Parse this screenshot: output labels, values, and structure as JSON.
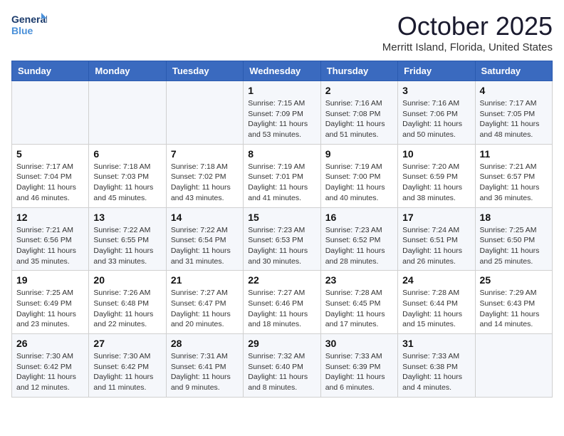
{
  "header": {
    "logo_line1": "General",
    "logo_line2": "Blue",
    "month": "October 2025",
    "location": "Merritt Island, Florida, United States"
  },
  "days_of_week": [
    "Sunday",
    "Monday",
    "Tuesday",
    "Wednesday",
    "Thursday",
    "Friday",
    "Saturday"
  ],
  "weeks": [
    [
      {
        "day": null,
        "info": null
      },
      {
        "day": null,
        "info": null
      },
      {
        "day": null,
        "info": null
      },
      {
        "day": "1",
        "info": "Sunrise: 7:15 AM\nSunset: 7:09 PM\nDaylight: 11 hours\nand 53 minutes."
      },
      {
        "day": "2",
        "info": "Sunrise: 7:16 AM\nSunset: 7:08 PM\nDaylight: 11 hours\nand 51 minutes."
      },
      {
        "day": "3",
        "info": "Sunrise: 7:16 AM\nSunset: 7:06 PM\nDaylight: 11 hours\nand 50 minutes."
      },
      {
        "day": "4",
        "info": "Sunrise: 7:17 AM\nSunset: 7:05 PM\nDaylight: 11 hours\nand 48 minutes."
      }
    ],
    [
      {
        "day": "5",
        "info": "Sunrise: 7:17 AM\nSunset: 7:04 PM\nDaylight: 11 hours\nand 46 minutes."
      },
      {
        "day": "6",
        "info": "Sunrise: 7:18 AM\nSunset: 7:03 PM\nDaylight: 11 hours\nand 45 minutes."
      },
      {
        "day": "7",
        "info": "Sunrise: 7:18 AM\nSunset: 7:02 PM\nDaylight: 11 hours\nand 43 minutes."
      },
      {
        "day": "8",
        "info": "Sunrise: 7:19 AM\nSunset: 7:01 PM\nDaylight: 11 hours\nand 41 minutes."
      },
      {
        "day": "9",
        "info": "Sunrise: 7:19 AM\nSunset: 7:00 PM\nDaylight: 11 hours\nand 40 minutes."
      },
      {
        "day": "10",
        "info": "Sunrise: 7:20 AM\nSunset: 6:59 PM\nDaylight: 11 hours\nand 38 minutes."
      },
      {
        "day": "11",
        "info": "Sunrise: 7:21 AM\nSunset: 6:57 PM\nDaylight: 11 hours\nand 36 minutes."
      }
    ],
    [
      {
        "day": "12",
        "info": "Sunrise: 7:21 AM\nSunset: 6:56 PM\nDaylight: 11 hours\nand 35 minutes."
      },
      {
        "day": "13",
        "info": "Sunrise: 7:22 AM\nSunset: 6:55 PM\nDaylight: 11 hours\nand 33 minutes."
      },
      {
        "day": "14",
        "info": "Sunrise: 7:22 AM\nSunset: 6:54 PM\nDaylight: 11 hours\nand 31 minutes."
      },
      {
        "day": "15",
        "info": "Sunrise: 7:23 AM\nSunset: 6:53 PM\nDaylight: 11 hours\nand 30 minutes."
      },
      {
        "day": "16",
        "info": "Sunrise: 7:23 AM\nSunset: 6:52 PM\nDaylight: 11 hours\nand 28 minutes."
      },
      {
        "day": "17",
        "info": "Sunrise: 7:24 AM\nSunset: 6:51 PM\nDaylight: 11 hours\nand 26 minutes."
      },
      {
        "day": "18",
        "info": "Sunrise: 7:25 AM\nSunset: 6:50 PM\nDaylight: 11 hours\nand 25 minutes."
      }
    ],
    [
      {
        "day": "19",
        "info": "Sunrise: 7:25 AM\nSunset: 6:49 PM\nDaylight: 11 hours\nand 23 minutes."
      },
      {
        "day": "20",
        "info": "Sunrise: 7:26 AM\nSunset: 6:48 PM\nDaylight: 11 hours\nand 22 minutes."
      },
      {
        "day": "21",
        "info": "Sunrise: 7:27 AM\nSunset: 6:47 PM\nDaylight: 11 hours\nand 20 minutes."
      },
      {
        "day": "22",
        "info": "Sunrise: 7:27 AM\nSunset: 6:46 PM\nDaylight: 11 hours\nand 18 minutes."
      },
      {
        "day": "23",
        "info": "Sunrise: 7:28 AM\nSunset: 6:45 PM\nDaylight: 11 hours\nand 17 minutes."
      },
      {
        "day": "24",
        "info": "Sunrise: 7:28 AM\nSunset: 6:44 PM\nDaylight: 11 hours\nand 15 minutes."
      },
      {
        "day": "25",
        "info": "Sunrise: 7:29 AM\nSunset: 6:43 PM\nDaylight: 11 hours\nand 14 minutes."
      }
    ],
    [
      {
        "day": "26",
        "info": "Sunrise: 7:30 AM\nSunset: 6:42 PM\nDaylight: 11 hours\nand 12 minutes."
      },
      {
        "day": "27",
        "info": "Sunrise: 7:30 AM\nSunset: 6:42 PM\nDaylight: 11 hours\nand 11 minutes."
      },
      {
        "day": "28",
        "info": "Sunrise: 7:31 AM\nSunset: 6:41 PM\nDaylight: 11 hours\nand 9 minutes."
      },
      {
        "day": "29",
        "info": "Sunrise: 7:32 AM\nSunset: 6:40 PM\nDaylight: 11 hours\nand 8 minutes."
      },
      {
        "day": "30",
        "info": "Sunrise: 7:33 AM\nSunset: 6:39 PM\nDaylight: 11 hours\nand 6 minutes."
      },
      {
        "day": "31",
        "info": "Sunrise: 7:33 AM\nSunset: 6:38 PM\nDaylight: 11 hours\nand 4 minutes."
      },
      {
        "day": null,
        "info": null
      }
    ]
  ]
}
